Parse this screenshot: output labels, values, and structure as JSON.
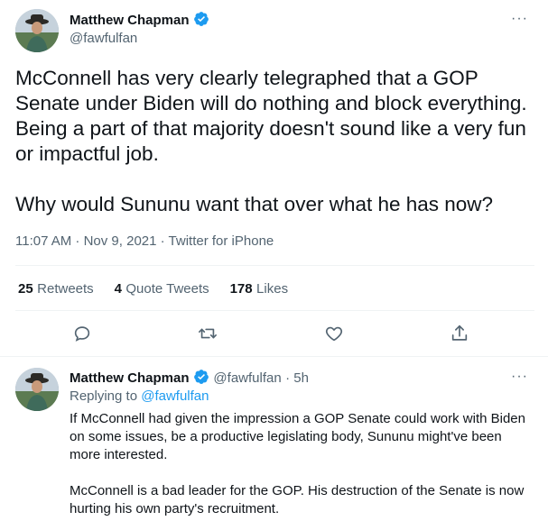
{
  "main_tweet": {
    "author_name": "Matthew Chapman",
    "author_handle": "@fawfulfan",
    "more": "···",
    "paragraph1": "McConnell has very clearly telegraphed that a GOP Senate under Biden will do nothing and block everything. Being a part of that majority doesn't sound like a very fun or impactful job.",
    "paragraph2": "Why would Sununu want that over what he has now?",
    "timestamp": "11:07 AM · Nov 9, 2021 · Twitter for iPhone"
  },
  "stats": {
    "retweets_count": "25",
    "retweets_label": "Retweets",
    "quotes_count": "4",
    "quotes_label": "Quote Tweets",
    "likes_count": "178",
    "likes_label": "Likes"
  },
  "actions": {
    "icons": [
      "reply-icon",
      "retweet-icon",
      "like-icon",
      "share-icon"
    ]
  },
  "reply_tweet": {
    "author_name": "Matthew Chapman",
    "author_handle": "@fawfulfan",
    "time": "· 5h",
    "more": "···",
    "replying_prefix": "Replying to ",
    "replying_handle": "@fawfulfan",
    "paragraph1": "If McConnell had given the impression a GOP Senate could work with Biden on some issues, be a productive legislating body, Sununu might've been more interested.",
    "paragraph2": "McConnell is a bad leader for the GOP. His destruction of the Senate is now hurting his own party's recruitment."
  },
  "colors": {
    "accent": "#1d9bf0",
    "text": "#0f1419",
    "secondary": "#536471",
    "divider": "#eff3f4"
  }
}
